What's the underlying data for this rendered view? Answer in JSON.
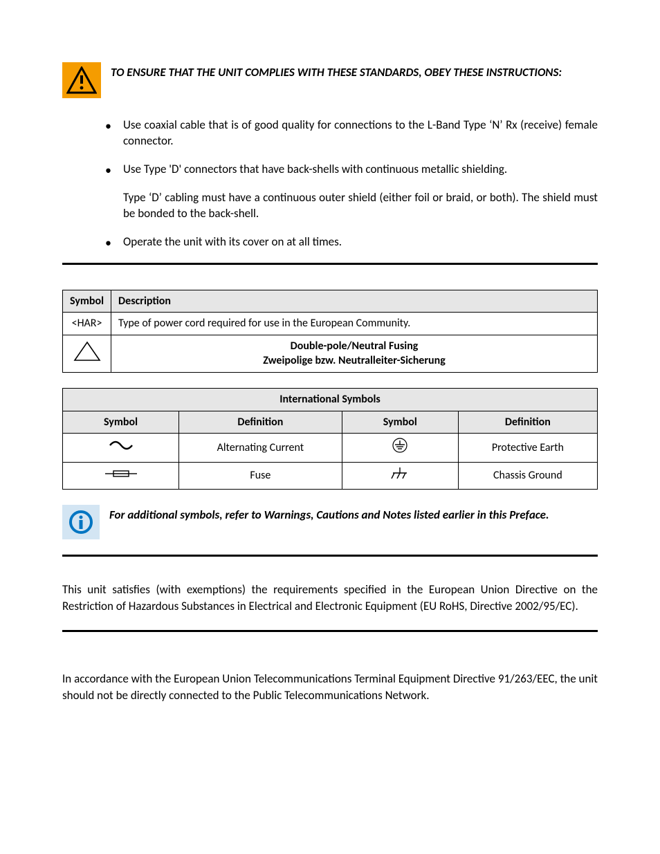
{
  "warning_heading": "TO ENSURE THAT THE UNIT COMPLIES WITH THESE STANDARDS, OBEY THESE INSTRUCTIONS:",
  "bullets": {
    "b1": "Use coaxial cable that is of good quality for connections to the L-Band Type ‘N’ Rx (receive) female connector.",
    "b2": "Use Type 'D' connectors that have back-shells with continuous metallic shielding.",
    "b2_sub": "Type ‘D’ cabling must have a continuous outer shield (either foil or braid, or both). The shield must be bonded to the back-shell.",
    "b3": "Operate the unit with its cover on at all times."
  },
  "table1": {
    "h1": "Symbol",
    "h2": "Description",
    "r1c1": "<HAR>",
    "r1c2": "Type of power cord required for use in the European Community.",
    "r2_line1": "Double-pole/Neutral Fusing",
    "r2_line2": "Zweipolige bzw. Neutralleiter-Sicherung"
  },
  "table2": {
    "title": "International Symbols",
    "h1": "Symbol",
    "h2": "Definition",
    "h3": "Symbol",
    "h4": "Definition",
    "d1": "Alternating Current",
    "d2": "Protective Earth",
    "d3": "Fuse",
    "d4": "Chassis Ground"
  },
  "note_text": "For additional symbols, refer to Warnings, Cautions and Notes listed earlier in this Preface.",
  "rohs_text": "This unit satisfies (with exemptions) the requirements specified in the European Union Directive on the Restriction of Hazardous Substances in Electrical and Electronic Equipment (EU RoHS, Directive 2002/95/EC).",
  "telecom_text": "In accordance with the European Union Telecommunications Terminal Equipment Directive 91/263/EEC, the unit should not be directly connected to the Public Telecommunications Network."
}
